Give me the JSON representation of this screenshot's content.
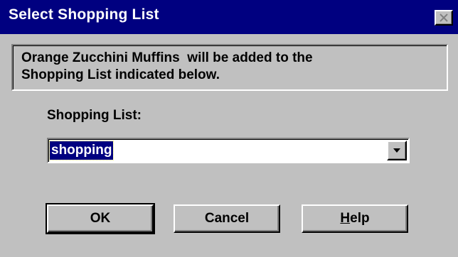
{
  "window": {
    "title": "Select Shopping List"
  },
  "message": {
    "line1": "Orange Zucchini Muffins  will be added to the",
    "line2": "Shopping List indicated below."
  },
  "shopping_list": {
    "label": "Shopping List:",
    "selected_value": "shopping"
  },
  "buttons": {
    "ok_label": "OK",
    "cancel_label": "Cancel",
    "help_label": "Help"
  },
  "icons": {
    "close": "close-icon",
    "dropdown": "chevron-down-icon"
  },
  "colors": {
    "titlebar": "#000080",
    "face": "#c0c0c0",
    "selection": "#000080"
  }
}
